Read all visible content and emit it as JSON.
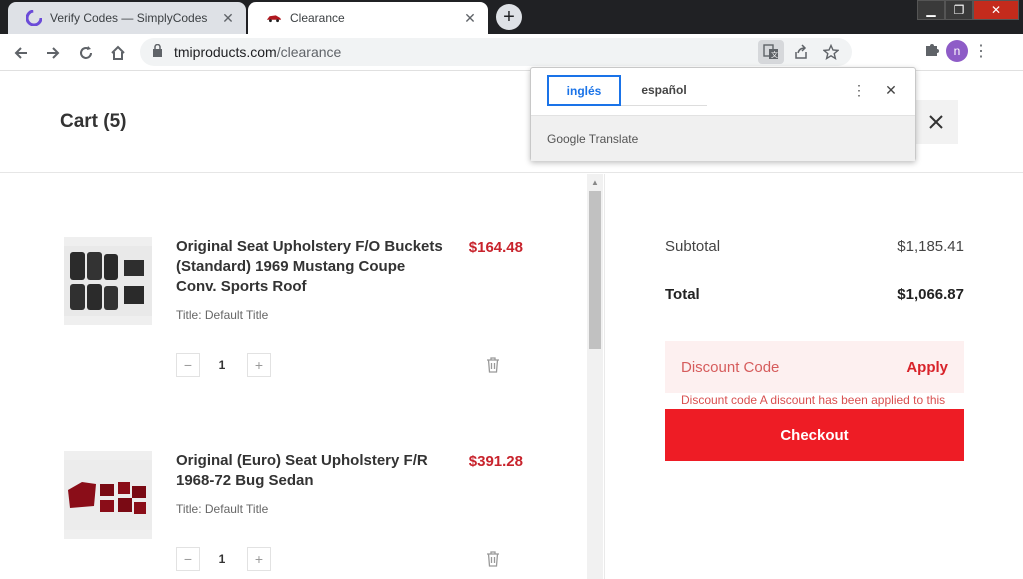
{
  "browser": {
    "tabs": [
      {
        "title": "Verify Codes — SimplyCodes",
        "icon": "simplycodes-icon",
        "active": false
      },
      {
        "title": "Clearance",
        "icon": "car-favicon",
        "active": true
      }
    ],
    "url_domain": "tmiproducts.com",
    "url_path": "/clearance",
    "profile_initial": "n"
  },
  "translate": {
    "source_language": "inglés",
    "target_language": "español",
    "brand": "Google",
    "product": "Translate"
  },
  "cart": {
    "title": "Cart (5)",
    "items": [
      {
        "name": "Original Seat Upholstery F/O Buckets (Standard) 1969 Mustang Coupe Conv. Sports Roof",
        "price": "$164.48",
        "variant": "Title: Default Title",
        "quantity": "1",
        "image": "black-seat-upholstery"
      },
      {
        "name": "Original (Euro) Seat Upholstery F/R 1968-72 Bug Sedan",
        "price": "$391.28",
        "variant": "Title: Default Title",
        "quantity": "1",
        "image": "red-seat-upholstery"
      }
    ]
  },
  "summary": {
    "subtotal_label": "Subtotal",
    "subtotal_value": "$1,185.41",
    "total_label": "Total",
    "total_value": "$1,066.87",
    "discount_placeholder": "Discount Code",
    "apply_label": "Apply",
    "discount_message": "Discount code A discount has been applied to this order. You can't add another discount.",
    "checkout_label": "Checkout"
  },
  "colors": {
    "accent_red": "#ee1c25",
    "price_red": "#c8232c",
    "translate_blue": "#1a73e8"
  }
}
